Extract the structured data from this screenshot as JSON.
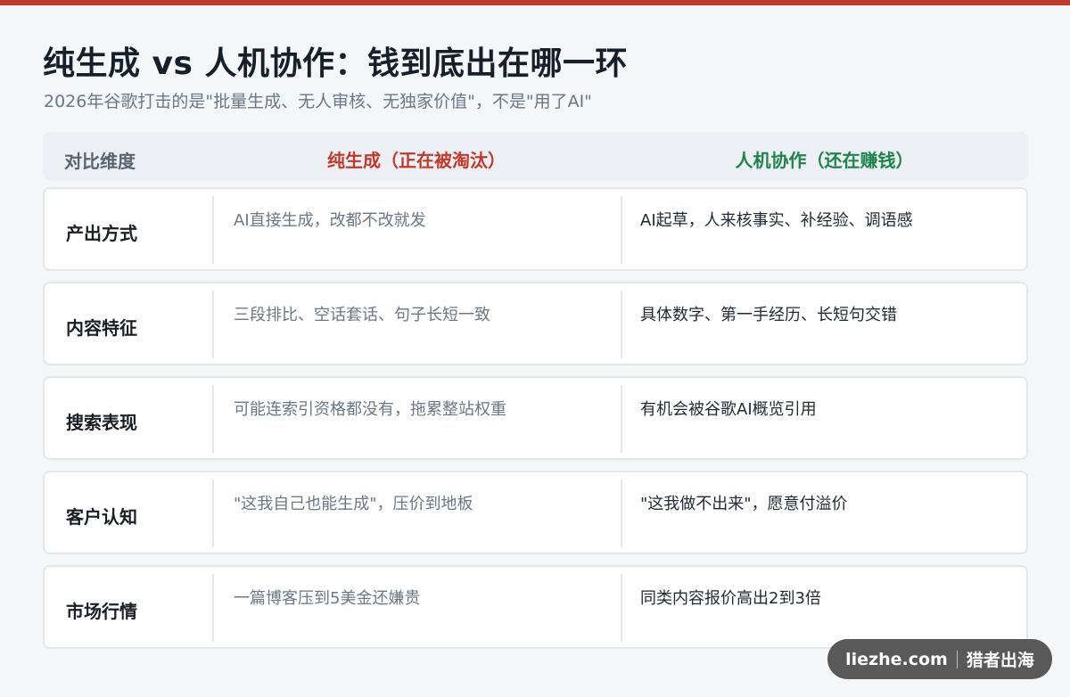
{
  "title": "纯生成 vs 人机协作：钱到底出在哪一环",
  "subtitle": "2026年谷歌打击的是\"批量生成、无人审核、无独家价值\"，不是\"用了AI\"",
  "table": {
    "headers": {
      "dimension": "对比维度",
      "pure": "纯生成（正在被淘汰）",
      "collab": "人机协作（还在赚钱）"
    },
    "rows": [
      {
        "dimension": "产出方式",
        "pure": "AI直接生成，改都不改就发",
        "collab": "AI起草，人来核事实、补经验、调语感"
      },
      {
        "dimension": "内容特征",
        "pure": "三段排比、空话套话、句子长短一致",
        "collab": "具体数字、第一手经历、长短句交错"
      },
      {
        "dimension": "搜索表现",
        "pure": "可能连索引资格都没有，拖累整站权重",
        "collab": "有机会被谷歌AI概览引用"
      },
      {
        "dimension": "客户认知",
        "pure": "\"这我自己也能生成\"，压价到地板",
        "collab": "\"这我做不出来\"，愿意付溢价"
      },
      {
        "dimension": "市场行情",
        "pure": "一篇博客压到5美金还嫌贵",
        "collab": "同类内容报价高出2到3倍"
      }
    ]
  },
  "badge": {
    "site": "liezhe.com",
    "brand": "猎者出海"
  },
  "colors": {
    "accent_red": "#c0392b",
    "accent_green": "#1e8449"
  }
}
